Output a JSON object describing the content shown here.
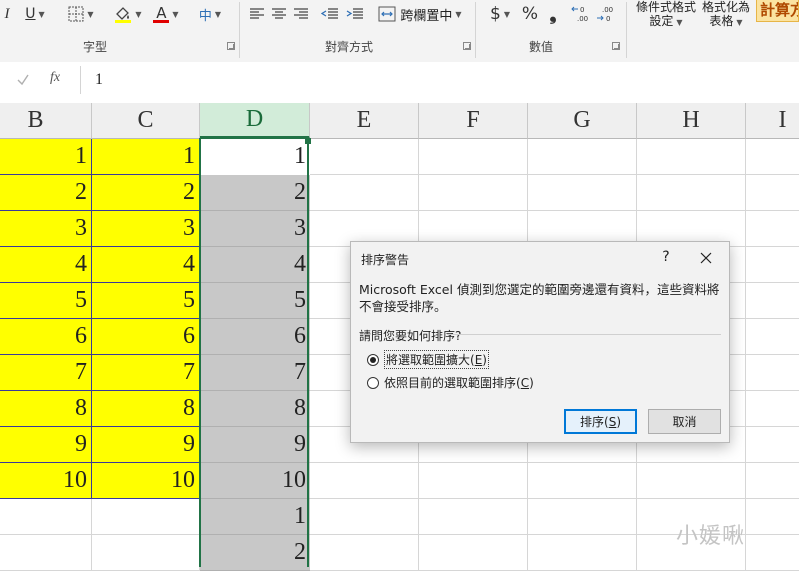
{
  "ribbon": {
    "groups": {
      "font": "字型",
      "alignment": "對齊方式",
      "number": "數值"
    },
    "wrap_merge_label": "跨欄置中",
    "currency_symbol": "$",
    "percent_symbol": "%",
    "comma_symbol": "❟",
    "conditional_format_label_1": "條件式格式",
    "conditional_format_label_2": "設定",
    "format_as_table_label_1": "格式化為",
    "format_as_table_label_2": "表格",
    "calc_label": "計算方",
    "underline_label": "U",
    "font_color_label": "A",
    "font_color": "#e00000",
    "phonetic_label": "中"
  },
  "formula_bar": {
    "fx_label": "fx",
    "value": "1"
  },
  "grid": {
    "columns": [
      "B",
      "C",
      "D",
      "E",
      "F",
      "G",
      "H",
      "I"
    ],
    "selected_column": "D",
    "col_b": [
      "1",
      "2",
      "3",
      "4",
      "5",
      "6",
      "7",
      "8",
      "9",
      "10"
    ],
    "col_c": [
      "1",
      "2",
      "3",
      "4",
      "5",
      "6",
      "7",
      "8",
      "9",
      "10"
    ],
    "col_d": [
      "1",
      "2",
      "3",
      "4",
      "5",
      "6",
      "7",
      "8",
      "9",
      "10",
      "1",
      "2"
    ],
    "yellow": "#ffff00",
    "gray": "#c8c8c8",
    "accent": "#217346"
  },
  "dialog": {
    "title": "排序警告",
    "help": "?",
    "message": "Microsoft Excel 偵測到您選定的範圍旁邊還有資料，這些資料將不會接受排序。",
    "question": "請問您要如何排序?",
    "option_expand_text": "將選取範圍擴大(",
    "option_expand_key": "E",
    "option_expand_end": ")",
    "option_current_text": "依照目前的選取範圍排序(",
    "option_current_key": "C",
    "option_current_end": ")",
    "sort_text": "排序(",
    "sort_key": "S",
    "sort_end": ")",
    "cancel": "取消"
  },
  "watermark": "小媛啾"
}
